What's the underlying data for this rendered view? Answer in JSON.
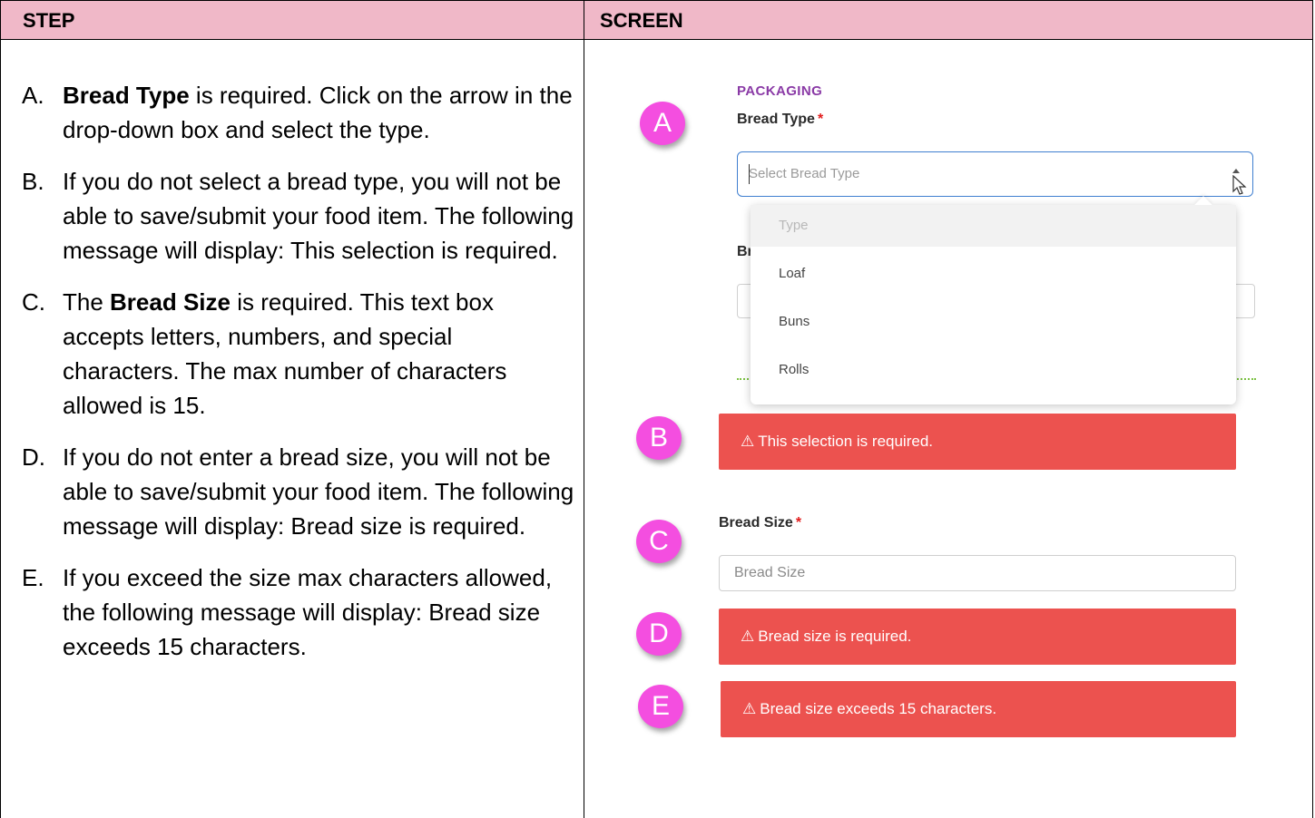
{
  "header": {
    "step_col": "STEP",
    "screen_col": "SCREEN"
  },
  "steps": [
    {
      "letter": "A.",
      "bold": "Bread Type",
      "rest": " is required.  Click on the arrow in the drop-down box and select the type."
    },
    {
      "letter": "B.",
      "bold": "",
      "rest": "If you do not select a bread type, you will not be able to save/submit your food item.  The following message will display:  This selection is required."
    },
    {
      "letter": "C.",
      "bold": "Bread Size",
      "pre": "The ",
      "rest": " is required. This text box accepts letters, numbers, and special characters. The max number of characters allowed is 15."
    },
    {
      "letter": "D.",
      "bold": "",
      "rest": "If you do not enter a bread size, you will not be able to save/submit your food item.  The following message will display:  Bread size is required."
    },
    {
      "letter": "E.",
      "bold": "",
      "rest": "If you exceed the size max characters allowed, the following message will display:  Bread size exceeds 15 characters."
    }
  ],
  "screen": {
    "section_title": "PACKAGING",
    "bread_type_label": "Bread Type",
    "required_mark": "*",
    "select_placeholder": "Select Bread Type",
    "partial_label": "Br",
    "dropdown_options": [
      "Type",
      "Loaf",
      "Buns",
      "Rolls"
    ],
    "badges": [
      "A",
      "B",
      "C",
      "D",
      "E"
    ],
    "alert_icon": "⚠",
    "alert_selection_required": "This selection is required.",
    "bread_size_label": "Bread Size",
    "bread_size_placeholder": "Bread Size",
    "alert_size_required": "Bread size is required.",
    "alert_size_exceeds": "Bread size exceeds 15 characters."
  },
  "colors": {
    "header_bg": "#f0b8c8",
    "badge": "#f44ee0",
    "alert": "#ec524f",
    "section_title": "#8a3aa6",
    "focus_border": "#3f7fd0"
  }
}
